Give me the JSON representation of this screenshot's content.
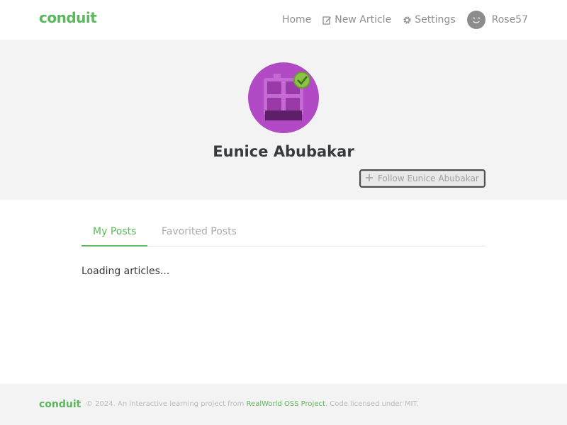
{
  "navbar": {
    "brand": "conduit",
    "items": [
      {
        "label": "Home"
      },
      {
        "label": "New Article",
        "icon": "compose-icon"
      },
      {
        "label": "Settings",
        "icon": "gear-icon"
      }
    ],
    "user": {
      "name": "Rose57",
      "avatar_icon": "smiley-avatar-icon"
    }
  },
  "profile": {
    "name": "Eunice Abubakar",
    "avatar_icon": "puzzle-avatar-icon",
    "follow_button": "Follow Eunice Abubakar",
    "follow_icon": "plus-icon"
  },
  "tabs": [
    {
      "label": "My Posts",
      "active": true
    },
    {
      "label": "Favorited Posts",
      "active": false
    }
  ],
  "feed": {
    "loading_text": "Loading articles..."
  },
  "footer": {
    "brand": "conduit",
    "text_before": "© 2024. An interactive learning project from",
    "link": "RealWorld OSS Project",
    "text_after": ". Code licensed under MIT."
  },
  "colors": {
    "accent": "#5cb85c",
    "banner_bg": "#f3f3f3",
    "avatar_bg": "#b14ac4"
  }
}
